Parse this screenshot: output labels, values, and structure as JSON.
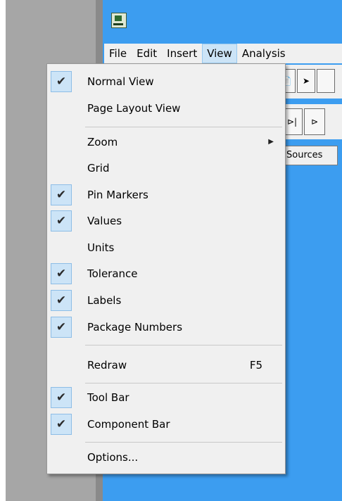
{
  "menubar": [
    "File",
    "Edit",
    "Insert",
    "View",
    "Analysis"
  ],
  "active_menu": "View",
  "sources_tab": "Sources",
  "view_menu": {
    "items": [
      {
        "label": "Normal View",
        "checked": true
      },
      {
        "label": "Page Layout View",
        "checked": false
      },
      {
        "label": "Zoom",
        "submenu": true
      },
      {
        "label": "Grid",
        "checked": false
      },
      {
        "label": "Pin Markers",
        "checked": true
      },
      {
        "label": "Values",
        "checked": true
      },
      {
        "label": "Units",
        "checked": false
      },
      {
        "label": "Tolerance",
        "checked": true
      },
      {
        "label": "Labels",
        "checked": true
      },
      {
        "label": "Package Numbers",
        "checked": true
      },
      {
        "label": "Redraw",
        "accel": "F5"
      },
      {
        "label": "Tool Bar",
        "checked": true
      },
      {
        "label": "Component Bar",
        "checked": true
      },
      {
        "label": "Options..."
      }
    ]
  },
  "colors": {
    "accent": "#3c9df0",
    "highlight": "#cce4f7"
  }
}
